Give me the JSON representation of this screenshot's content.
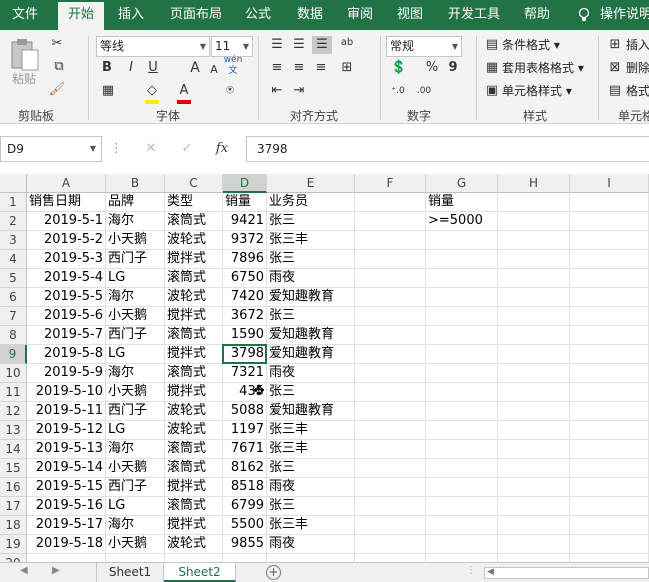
{
  "ribbon_tabs": [
    "文件",
    "开始",
    "插入",
    "页面布局",
    "公式",
    "数据",
    "审阅",
    "视图",
    "开发工具",
    "帮助",
    "操作说明"
  ],
  "active_tab": "开始",
  "ribbon": {
    "clipboard": {
      "paste_label": "粘贴",
      "group_label": "剪贴板"
    },
    "font": {
      "name": "等线",
      "size": "11",
      "group_label": "字体",
      "bold": "B",
      "italic": "I",
      "underline": "U",
      "grow": "A",
      "shrink": "A",
      "phonetic": "wén",
      "phonetic_sub": "文"
    },
    "alignment": {
      "group_label": "对齐方式",
      "wrap": "ab"
    },
    "number": {
      "format": "常规",
      "group_label": "数字",
      "percent": "%",
      "comma": "9"
    },
    "styles": {
      "conditional": "条件格式",
      "table": "套用表格格式",
      "cell": "单元格样式",
      "group_label": "样式"
    },
    "cells": {
      "insert": "插入",
      "delete": "删除",
      "format": "格式",
      "group_label": "单元格"
    }
  },
  "formula_bar": {
    "name_box": "D9",
    "fx": "fx",
    "value": "3798"
  },
  "columns": [
    "A",
    "B",
    "C",
    "D",
    "E",
    "F",
    "G",
    "H",
    "I"
  ],
  "selected_column": "D",
  "selected_row": "9",
  "header_row": [
    "销售日期",
    "品牌",
    "类型",
    "销量",
    "业务员"
  ],
  "criteria": {
    "header": "销量",
    "value": ">=5000"
  },
  "rows": [
    [
      "2019-5-1",
      "海尔",
      "滚筒式",
      "9421",
      "张三"
    ],
    [
      "2019-5-2",
      "小天鹅",
      "波轮式",
      "9372",
      "张三丰"
    ],
    [
      "2019-5-3",
      "西门子",
      "搅拌式",
      "7896",
      "张三"
    ],
    [
      "2019-5-4",
      "LG",
      "滚筒式",
      "6750",
      "雨夜"
    ],
    [
      "2019-5-5",
      "海尔",
      "波轮式",
      "7420",
      "爱知趣教育"
    ],
    [
      "2019-5-6",
      "小天鹅",
      "搅拌式",
      "3672",
      "张三"
    ],
    [
      "2019-5-7",
      "西门子",
      "滚筒式",
      "1590",
      "爱知趣教育"
    ],
    [
      "2019-5-8",
      "LG",
      "搅拌式",
      "3798",
      "爱知趣教育"
    ],
    [
      "2019-5-9",
      "海尔",
      "滚筒式",
      "7321",
      "雨夜"
    ],
    [
      "2019-5-10",
      "小天鹅",
      "搅拌式",
      "435",
      "张三"
    ],
    [
      "2019-5-11",
      "西门子",
      "波轮式",
      "5088",
      "爱知趣教育"
    ],
    [
      "2019-5-12",
      "LG",
      "波轮式",
      "1197",
      "张三丰"
    ],
    [
      "2019-5-13",
      "海尔",
      "滚筒式",
      "7671",
      "张三丰"
    ],
    [
      "2019-5-14",
      "小天鹅",
      "滚筒式",
      "8162",
      "张三"
    ],
    [
      "2019-5-15",
      "西门子",
      "搅拌式",
      "8518",
      "雨夜"
    ],
    [
      "2019-5-16",
      "LG",
      "滚筒式",
      "6799",
      "张三"
    ],
    [
      "2019-5-17",
      "海尔",
      "搅拌式",
      "5500",
      "张三丰"
    ],
    [
      "2019-5-18",
      "小天鹅",
      "波轮式",
      "9855",
      "雨夜"
    ]
  ],
  "sheets": [
    "Sheet1",
    "Sheet2"
  ],
  "active_sheet": "Sheet2",
  "colors": {
    "brand": "#217346",
    "ribbon_bg": "#f3f3f3",
    "header_bg": "#f0f0f0"
  }
}
